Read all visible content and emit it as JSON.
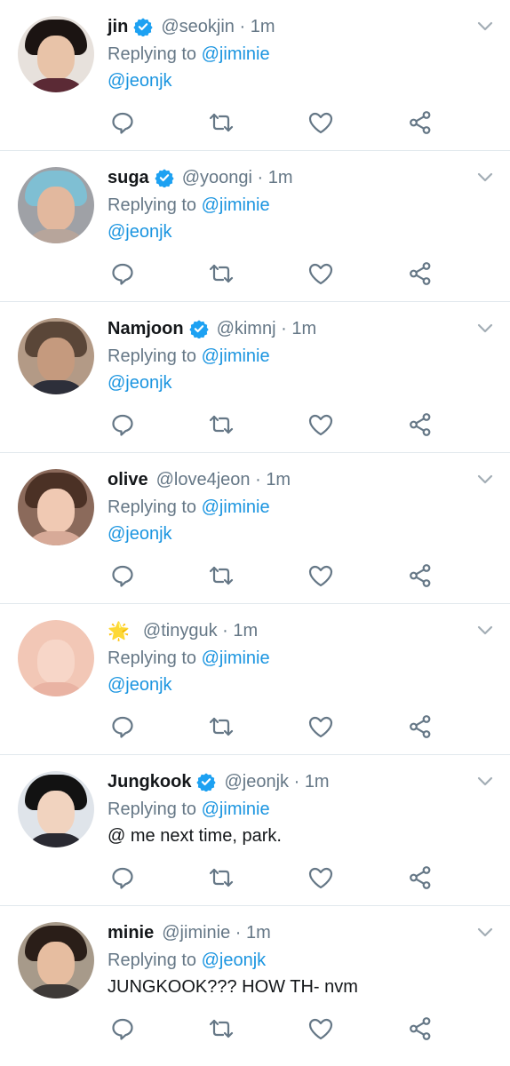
{
  "colors": {
    "link": "#1b95e0",
    "muted": "#657786",
    "text": "#14171a",
    "verified": "#1da1f2",
    "divider": "#e1e8ed"
  },
  "tweets": [
    {
      "name": "jin",
      "verified": true,
      "handle": "@seokjin",
      "sep": "·",
      "time": "1m",
      "replying_prefix": "Replying to",
      "replying_to": "@jiminie",
      "body": "@jeonjk",
      "body_style": "link",
      "avatar": {
        "bg": "#e7e1dc",
        "hair": "#1b1412",
        "face": "#e8c3a8",
        "body": "#5b2a35"
      }
    },
    {
      "name": "suga",
      "verified": true,
      "handle": "@yoongi",
      "sep": "·",
      "time": "1m",
      "replying_prefix": "Replying to",
      "replying_to": "@jiminie",
      "body": "@jeonjk",
      "body_style": "link",
      "avatar": {
        "bg": "#9fa1a6",
        "hair": "#7fbfd3",
        "face": "#e2b89e",
        "body": "#b7a59b"
      }
    },
    {
      "name": "Namjoon",
      "verified": true,
      "handle": "@kimnj",
      "sep": "·",
      "time": "1m",
      "replying_prefix": "Replying to",
      "replying_to": "@jiminie",
      "body": "@jeonjk",
      "body_style": "link",
      "avatar": {
        "bg": "#b39a86",
        "hair": "#5a4638",
        "face": "#c59a7e",
        "body": "#2d2f3a"
      }
    },
    {
      "name": "olive",
      "verified": false,
      "handle": "@love4jeon",
      "sep": "·",
      "time": "1m",
      "replying_prefix": "Replying to",
      "replying_to": "@jiminie",
      "body": "@jeonjk",
      "body_style": "link",
      "avatar": {
        "bg": "#8b6a5b",
        "hair": "#4b3125",
        "face": "#f0c9b3",
        "body": "#d7aa98"
      }
    },
    {
      "name": "",
      "verified": false,
      "emoji": "🌟",
      "handle": "@tinyguk",
      "sep": "·",
      "time": "1m",
      "replying_prefix": "Replying to",
      "replying_to": "@jiminie",
      "body": "@jeonjk",
      "body_style": "link",
      "avatar": {
        "bg": "#f2c7b6",
        "hair": "#f2c7b6",
        "face": "#f7d6c8",
        "body": "#e9b3a3"
      }
    },
    {
      "name": "Jungkook",
      "verified": true,
      "handle": "@jeonjk",
      "sep": "·",
      "time": "1m",
      "replying_prefix": "Replying to",
      "replying_to": "@jiminie",
      "body": "@ me next time, park.",
      "body_style": "text",
      "avatar": {
        "bg": "#dfe4ea",
        "hair": "#121212",
        "face": "#f1d3bf",
        "body": "#2a2a32"
      }
    },
    {
      "name": "minie",
      "verified": false,
      "handle": "@jiminie",
      "sep": "·",
      "time": "1m",
      "replying_prefix": "Replying to",
      "replying_to": "@jeonjk",
      "body": "JUNGKOOK??? HOW TH- nvm",
      "body_style": "text",
      "avatar": {
        "bg": "#a79a8a",
        "hair": "#2a1e18",
        "face": "#e6bda0",
        "body": "#3e3a38"
      }
    }
  ]
}
